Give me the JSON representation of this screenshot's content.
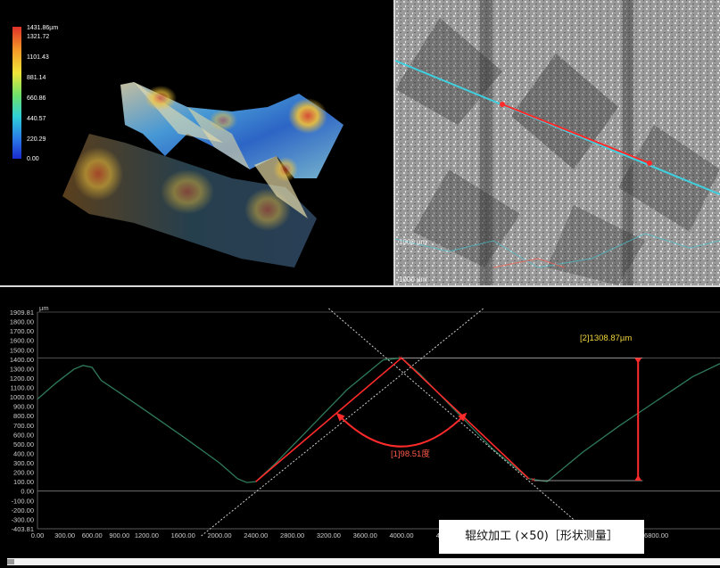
{
  "view3d": {
    "legend_values": [
      "1431.86µm",
      "1321.72",
      "1101.43",
      "881.14",
      "660.86",
      "440.57",
      "220.29",
      "0.00"
    ]
  },
  "microscope": {
    "scale_labels": [
      "1000 µm",
      "1000 µm"
    ]
  },
  "profile": {
    "y_unit": "µm",
    "y_ticks": [
      "1909.81",
      "1800.00",
      "1700.00",
      "1600.00",
      "1500.00",
      "1400.00",
      "1300.00",
      "1200.00",
      "1100.00",
      "1000.00",
      "900.00",
      "800.00",
      "700.00",
      "600.00",
      "500.00",
      "400.00",
      "300.00",
      "200.00",
      "100.00",
      "0.00",
      "-100.00",
      "-200.00",
      "-300.00",
      "-403.81"
    ],
    "x_ticks": [
      "0.00",
      "300.00",
      "600.00",
      "900.00",
      "1200.00",
      "1600.00",
      "2000.00",
      "2400.00",
      "2800.00",
      "3200.00",
      "3600.00",
      "4000.00",
      "4",
      "6800.00"
    ],
    "angle_label": "[1]98.51度",
    "height_label": "[2]1308.87µm"
  },
  "caption": "辊纹加工 (×50)［形状测量］",
  "colors": {
    "profile_line": "#2e7a5a",
    "measure_red": "#ff2a2a",
    "accent_cyan": "#3fd0e0",
    "label_yellow": "#f0d63a"
  },
  "chart_data": {
    "type": "line",
    "xlabel": "",
    "ylabel": "µm",
    "xlim": [
      0,
      7500
    ],
    "ylim": [
      -403.81,
      1909.81
    ],
    "series": [
      {
        "x": [
          0,
          200,
          400,
          500,
          600,
          700,
          900,
          1200,
          1600,
          2000,
          2200,
          2300,
          2400,
          2600,
          3000,
          3400,
          3800,
          4000,
          4200,
          4600,
          5000,
          5400,
          5600,
          6000,
          6400,
          6800,
          7200,
          7500
        ],
        "values": [
          980,
          1150,
          1300,
          1340,
          1320,
          1180,
          1050,
          850,
          580,
          300,
          130,
          90,
          100,
          280,
          680,
          1080,
          1400,
          1420,
          1250,
          850,
          450,
          130,
          100,
          420,
          700,
          960,
          1220,
          1360
        ]
      }
    ],
    "annotations": [
      {
        "label": "[1]98.51度",
        "type": "angle"
      },
      {
        "label": "[2]1308.87µm",
        "type": "height"
      }
    ]
  }
}
